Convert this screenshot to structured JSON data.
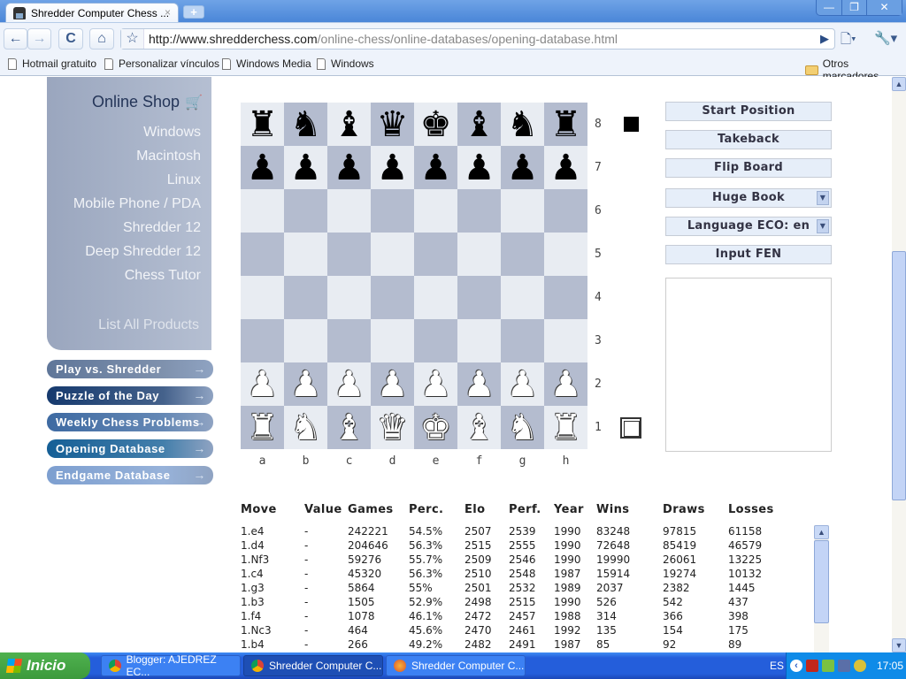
{
  "browser": {
    "tab_title": "Shredder Computer Chess ...",
    "tab_close": "×",
    "new_tab": "+",
    "window_controls": {
      "minimize": "—",
      "restore": "❐",
      "close": "✕"
    },
    "nav": {
      "back": "←",
      "forward": "→",
      "reload": "C",
      "home": "⌂",
      "star": "☆",
      "go": "▶",
      "page_menu": "🗋▾",
      "tools_menu": "🔧▾"
    },
    "url_host": "http://www.shredderchess.com",
    "url_path": "/online-chess/online-databases/opening-database.html",
    "bookmarks": [
      "Hotmail gratuito",
      "Personalizar vínculos",
      "Windows Media",
      "Windows"
    ],
    "other_bookmarks": "Otros marcadores"
  },
  "sidebar": {
    "shop_title": "Online Shop",
    "shop_items": [
      "Windows",
      "Macintosh",
      "Linux",
      "Mobile Phone / PDA",
      "Shredder 12",
      "Deep Shredder 12",
      "Chess Tutor"
    ],
    "list_all": "List All Products",
    "nav_buttons": [
      {
        "label": "Play vs. Shredder",
        "color": "#5f7699"
      },
      {
        "label": "Puzzle of the Day",
        "color": "#163a6e"
      },
      {
        "label": "Weekly Chess Problems",
        "color": "#3e6aa2"
      },
      {
        "label": "Opening Database",
        "color": "#155f96"
      },
      {
        "label": "Endgame Database",
        "color": "#7d9fd0"
      }
    ],
    "arrow": "→"
  },
  "board": {
    "ranks": [
      "8",
      "7",
      "6",
      "5",
      "4",
      "3",
      "2",
      "1"
    ],
    "files": [
      "a",
      "b",
      "c",
      "d",
      "e",
      "f",
      "g",
      "h"
    ],
    "position": [
      [
        "r",
        "n",
        "b",
        "q",
        "k",
        "b",
        "n",
        "r"
      ],
      [
        "p",
        "p",
        "p",
        "p",
        "p",
        "p",
        "p",
        "p"
      ],
      [
        "",
        "",
        "",
        "",
        "",
        "",
        "",
        ""
      ],
      [
        "",
        "",
        "",
        "",
        "",
        "",
        "",
        ""
      ],
      [
        "",
        "",
        "",
        "",
        "",
        "",
        "",
        ""
      ],
      [
        "",
        "",
        "",
        "",
        "",
        "",
        "",
        ""
      ],
      [
        "P",
        "P",
        "P",
        "P",
        "P",
        "P",
        "P",
        "P"
      ],
      [
        "R",
        "N",
        "B",
        "Q",
        "K",
        "B",
        "N",
        "R"
      ]
    ],
    "colors": {
      "light": "#e8ecf2",
      "dark": "#b4bccf"
    }
  },
  "controls": {
    "start_position": "Start Position",
    "takeback": "Takeback",
    "flip_board": "Flip Board",
    "book_select": "Huge Book",
    "language_select": "Language ECO: en",
    "input_fen": "Input FEN",
    "dropdown_icon": "▼"
  },
  "table": {
    "headers": [
      "Move",
      "Value",
      "Games",
      "Perc.",
      "Elo",
      "Perf.",
      "Year",
      "Wins",
      "Draws",
      "Losses"
    ],
    "rows": [
      [
        "1.e4",
        "-",
        "242221",
        "54.5%",
        "2507",
        "2539",
        "1990",
        "83248",
        "97815",
        "61158"
      ],
      [
        "1.d4",
        "-",
        "204646",
        "56.3%",
        "2515",
        "2555",
        "1990",
        "72648",
        "85419",
        "46579"
      ],
      [
        "1.Nf3",
        "-",
        "59276",
        "55.7%",
        "2509",
        "2546",
        "1990",
        "19990",
        "26061",
        "13225"
      ],
      [
        "1.c4",
        "-",
        "45320",
        "56.3%",
        "2510",
        "2548",
        "1987",
        "15914",
        "19274",
        "10132"
      ],
      [
        "1.g3",
        "-",
        "5864",
        "55%",
        "2501",
        "2532",
        "1989",
        "2037",
        "2382",
        "1445"
      ],
      [
        "1.b3",
        "-",
        "1505",
        "52.9%",
        "2498",
        "2515",
        "1990",
        "526",
        "542",
        "437"
      ],
      [
        "1.f4",
        "-",
        "1078",
        "46.1%",
        "2472",
        "2457",
        "1988",
        "314",
        "366",
        "398"
      ],
      [
        "1.Nc3",
        "-",
        "464",
        "45.6%",
        "2470",
        "2461",
        "1992",
        "135",
        "154",
        "175"
      ],
      [
        "1.b4",
        "-",
        "266",
        "49.2%",
        "2482",
        "2491",
        "1987",
        "85",
        "92",
        "89"
      ]
    ]
  },
  "taskbar": {
    "start": "Inicio",
    "tasks": [
      {
        "label": "Blogger: AJEDREZ EC...",
        "active": false
      },
      {
        "label": "Shredder Computer C...",
        "active": true
      },
      {
        "label": "Shredder Computer C...",
        "active": false
      }
    ],
    "language": "ES",
    "clock": "17:05"
  }
}
